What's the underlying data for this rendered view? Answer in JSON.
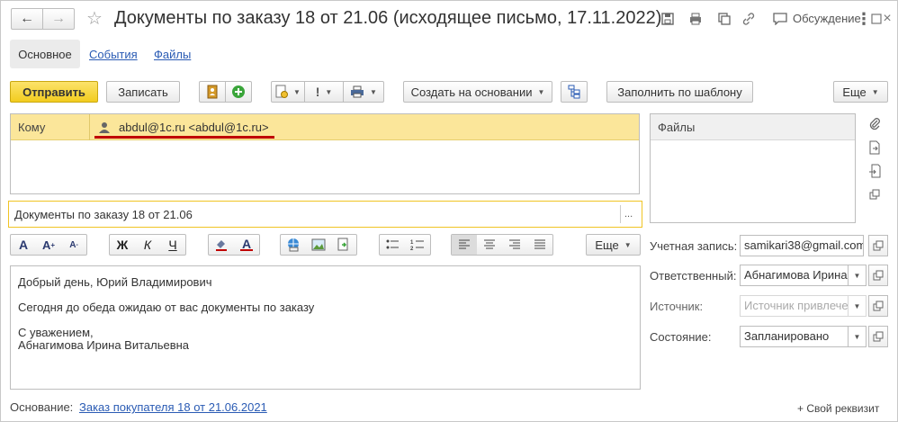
{
  "window": {
    "title": "Документы по заказу 18 от 21.06 (исходящее письмо, 17.11.2022)",
    "discussion_label": "Обсуждение"
  },
  "tabs": [
    {
      "label": "Основное"
    },
    {
      "label": "События"
    },
    {
      "label": "Файлы"
    }
  ],
  "toolbar": {
    "send_label": "Отправить",
    "save_label": "Записать",
    "create_based_label": "Создать на основании",
    "fill_template_label": "Заполнить по шаблону",
    "more_label": "Еще"
  },
  "recipients": {
    "to_label": "Кому",
    "to_value": "abdul@1c.ru <abdul@1c.ru>"
  },
  "files_panel": {
    "header": "Файлы"
  },
  "subject": {
    "value": "Документы по заказу 18 от 21.06",
    "ellipsis": "..."
  },
  "format_toolbar": {
    "bold": "Ж",
    "italic": "К",
    "underline": "Ч",
    "more_label": "Еще"
  },
  "body": {
    "line1": "Добрый день, Юрий Владимирович",
    "line2": "Сегодня до обеда ожидаю от вас документы по заказу",
    "line3": "С уважением,",
    "line4": "Абнагимова Ирина Витальевна"
  },
  "side_fields": {
    "account_label": "Учетная запись:",
    "account_value": "samikari38@gmail.com",
    "responsible_label": "Ответственный:",
    "responsible_value": "Абнагимова Ирина",
    "source_label": "Источник:",
    "source_placeholder": "Источник привлечения",
    "state_label": "Состояние:",
    "state_value": "Запланировано"
  },
  "footer": {
    "basis_label": "Основание:",
    "basis_link": "Заказ покупателя 18 от 21.06.2021",
    "custom_attr": "+ Свой реквизит"
  },
  "colors": {
    "accent_yellow": "#f5d22a",
    "highlight_row": "#fbe69a",
    "link": "#2a5bb4",
    "underline_red": "#c00000"
  }
}
